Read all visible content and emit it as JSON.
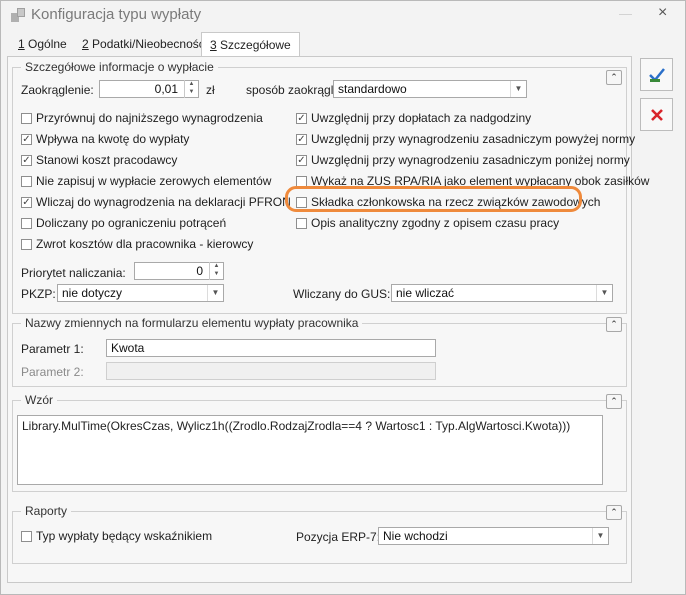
{
  "window": {
    "title": "Konfiguracja typu wypłaty",
    "minimize": "—",
    "close": "×"
  },
  "tabs": [
    {
      "key": "1",
      "label": " Ogólne",
      "active": false
    },
    {
      "key": "2",
      "label": " Podatki/Nieobecności",
      "active": false
    },
    {
      "key": "3",
      "label": " Szczegółowe",
      "active": true
    }
  ],
  "details": {
    "title": "Szczegółowe informacje o wypłacie",
    "rounding_label": "Zaokrąglenie:",
    "rounding_value": "0,01",
    "rounding_unit": "zł",
    "rounding_method_label": "sposób zaokrąglenia:",
    "rounding_method_value": "standardowo",
    "left_checks": [
      {
        "label": "Przyrównuj do najniższego wynagrodzenia",
        "checked": false
      },
      {
        "label": "Wpływa na kwotę do wypłaty",
        "checked": true
      },
      {
        "label": "Stanowi koszt pracodawcy",
        "checked": true
      },
      {
        "label": "Nie zapisuj w wypłacie zerowych elementów",
        "checked": false
      },
      {
        "label": "Wliczaj do wynagrodzenia na deklaracji PFRON",
        "checked": true
      },
      {
        "label": "Doliczany po ograniczeniu potrąceń",
        "checked": false
      },
      {
        "label": "Zwrot kosztów dla pracownika - kierowcy",
        "checked": false
      }
    ],
    "right_checks": [
      {
        "label": "Uwzględnij przy dopłatach za nadgodziny",
        "checked": true
      },
      {
        "label": "Uwzględnij przy wynagrodzeniu zasadniczym powyżej normy",
        "checked": true
      },
      {
        "label": "Uwzględnij przy wynagrodzeniu zasadniczym poniżej normy",
        "checked": true
      },
      {
        "label": "Wykaż na ZUS RPA/RIA jako element wypłacany obok zasiłków",
        "checked": false
      },
      {
        "label": "Składka członkowska na rzecz związków zawodowych",
        "checked": false
      },
      {
        "label": "Opis analityczny zgodny z opisem czasu pracy",
        "checked": false
      }
    ],
    "priority_label": "Priorytet naliczania:",
    "priority_value": "0",
    "pkzp_label": "PKZP:",
    "pkzp_value": "nie dotyczy",
    "gus_label": "Wliczany do GUS:",
    "gus_value": "nie wliczać"
  },
  "variables": {
    "title": "Nazwy zmiennych na formularzu elementu wypłaty pracownika",
    "param1_label": "Parametr 1:",
    "param1_value": "Kwota",
    "param2_label": "Parametr 2:",
    "param2_value": ""
  },
  "formula": {
    "title": "Wzór",
    "text": "Library.MulTime(OkresCzas, Wylicz1h((Zrodlo.RodzajZrodla==4 ? Wartosc1 : Typ.AlgWartosci.Kwota)))"
  },
  "reports": {
    "title": "Raporty",
    "indicator_label": "Typ wypłaty będący wskaźnikiem",
    "indicator_checked": false,
    "erp_label": "Pozycja ERP-7:",
    "erp_value": "Nie wchodzi"
  },
  "collapse_glyph": "⌃",
  "colors": {
    "accent_highlight": "#ef8a3c",
    "save_blue": "#2a6fc9",
    "cancel_red": "#d8232a"
  }
}
